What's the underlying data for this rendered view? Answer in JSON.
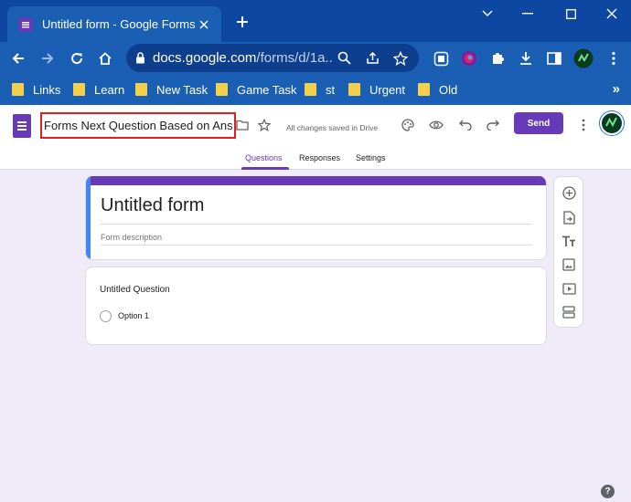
{
  "browser": {
    "tab": {
      "title": "Untitled form - Google Forms"
    },
    "address": {
      "domain": "docs.google.com",
      "path": "/forms/d/1a..."
    },
    "bookmarks": [
      {
        "label": "Links"
      },
      {
        "label": "Learn"
      },
      {
        "label": "New Task"
      },
      {
        "label": "Game Task"
      },
      {
        "label": "st"
      },
      {
        "label": "Urgent"
      },
      {
        "label": "Old"
      }
    ],
    "bookmarks_more": "»"
  },
  "forms_header": {
    "title_value": "Forms Next Question Based on Answer",
    "saved_status": "All changes saved in Drive",
    "send_label": "Send",
    "tabs": [
      {
        "label": "Questions",
        "active": true
      },
      {
        "label": "Responses",
        "active": false
      },
      {
        "label": "Settings",
        "active": false
      }
    ]
  },
  "form": {
    "title": "Untitled form",
    "description_placeholder": "Form description"
  },
  "question": {
    "title": "Untitled Question",
    "option": "Option 1"
  },
  "colors": {
    "accent": "#673ab7",
    "chrome_dark": "#0d47a1",
    "chrome": "#1a5fb4",
    "highlight": "#e02020",
    "page_bg": "#f0ebf8"
  },
  "help_glyph": "?"
}
